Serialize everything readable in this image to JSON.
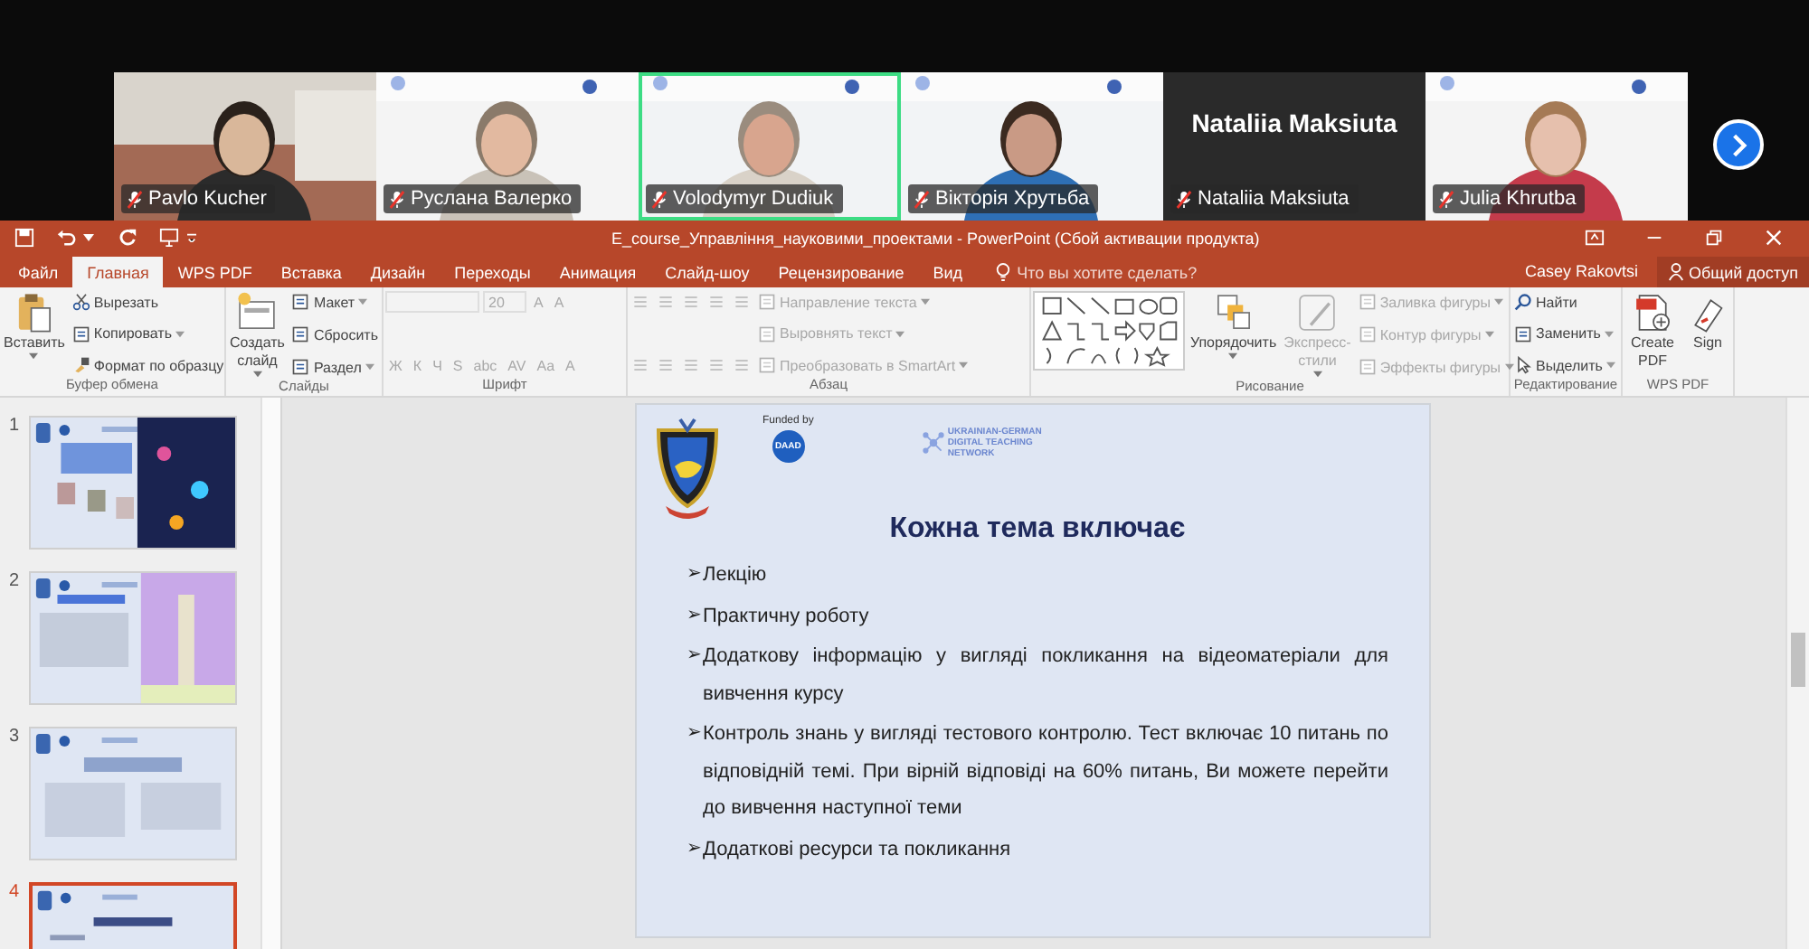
{
  "participants": [
    {
      "name": "Pavlo Kucher",
      "kind": "video",
      "muted": true,
      "selected": false
    },
    {
      "name": "Руслана Валерко",
      "kind": "video",
      "muted": true,
      "selected": false
    },
    {
      "name": "Volodymyr Dudiuk",
      "kind": "video",
      "muted": true,
      "selected": true
    },
    {
      "name": "Вікторія Хрутьба",
      "kind": "video",
      "muted": true,
      "selected": false
    },
    {
      "name": "Nataliia Maksiuta",
      "kind": "name",
      "display_name": "Nataliia Maksiuta",
      "muted": true,
      "selected": false
    },
    {
      "name": "Julia Khrutba",
      "kind": "video",
      "muted": true,
      "selected": false
    }
  ],
  "powerpoint": {
    "title": "E_course_Управління_науковими_проектами - PowerPoint (Сбой активации продукта)",
    "tabs": [
      {
        "label": "Файл",
        "selected": false
      },
      {
        "label": "Главная",
        "selected": true
      },
      {
        "label": "WPS PDF",
        "selected": false
      },
      {
        "label": "Вставка",
        "selected": false
      },
      {
        "label": "Дизайн",
        "selected": false
      },
      {
        "label": "Переходы",
        "selected": false
      },
      {
        "label": "Анимация",
        "selected": false
      },
      {
        "label": "Слайд-шоу",
        "selected": false
      },
      {
        "label": "Рецензирование",
        "selected": false
      },
      {
        "label": "Вид",
        "selected": false
      }
    ],
    "tell_me": {
      "placeholder": "Что вы хотите сделать?"
    },
    "user": "Casey Rakovtsi",
    "share": "Общий доступ",
    "ribbon": [
      {
        "label": "Буфер обмена",
        "columns": [
          [
            [
              {
                "kind": "large",
                "label": "Вставить",
                "dropdown": true,
                "disabled": false
              }
            ]
          ],
          [
            [
              {
                "kind": "small",
                "label": "Вырезать",
                "dropdown": false,
                "disabled": false
              }
            ],
            [
              {
                "kind": "small",
                "label": "Копировать",
                "dropdown": true,
                "disabled": false
              }
            ],
            [
              {
                "kind": "small",
                "label": "Формат по образцу",
                "dropdown": false,
                "disabled": false
              }
            ]
          ]
        ]
      },
      {
        "label": "Слайды",
        "columns": [
          [
            [
              {
                "kind": "large",
                "label": "Создать слайд",
                "dropdown": true,
                "disabled": false
              }
            ]
          ],
          [
            [
              {
                "kind": "small",
                "label": "Макет",
                "dropdown": true,
                "disabled": false
              }
            ],
            [
              {
                "kind": "small",
                "label": "Сбросить",
                "dropdown": false,
                "disabled": false
              }
            ],
            [
              {
                "kind": "small",
                "label": "Раздел",
                "dropdown": true,
                "disabled": false
              }
            ]
          ]
        ]
      },
      {
        "label": "Шрифт",
        "columns": [
          [
            [
              {
                "kind": "field",
                "disabled": true
              },
              {
                "kind": "field",
                "value": "20",
                "disabled": true
              },
              {
                "kind": "glyph",
                "label": "A",
                "disabled": true
              },
              {
                "kind": "glyph",
                "label": "A",
                "disabled": true
              }
            ],
            [
              {
                "kind": "glyph",
                "label": "Ж",
                "disabled": true
              },
              {
                "kind": "glyph",
                "label": "К",
                "disabled": true
              },
              {
                "kind": "glyph",
                "label": "Ч",
                "disabled": true
              },
              {
                "kind": "glyph",
                "label": "S",
                "disabled": true
              },
              {
                "kind": "glyph",
                "label": "abc",
                "disabled": true
              },
              {
                "kind": "glyph",
                "label": "AV",
                "disabled": true
              },
              {
                "kind": "glyph",
                "label": "Aa",
                "disabled": true
              },
              {
                "kind": "glyph",
                "label": "A",
                "disabled": true
              }
            ]
          ]
        ]
      },
      {
        "label": "Абзац",
        "columns": [
          [
            [
              {
                "kind": "icon",
                "disabled": true
              },
              {
                "kind": "icon",
                "disabled": true
              },
              {
                "kind": "icon",
                "disabled": true
              },
              {
                "kind": "icon",
                "disabled": true
              },
              {
                "kind": "icon",
                "disabled": true
              }
            ],
            [
              {
                "kind": "icon",
                "disabled": true
              },
              {
                "kind": "icon",
                "disabled": true
              },
              {
                "kind": "icon",
                "disabled": true
              },
              {
                "kind": "icon",
                "disabled": true
              },
              {
                "kind": "icon",
                "disabled": true
              }
            ]
          ],
          [
            [
              {
                "kind": "small",
                "label": "Направление текста",
                "dropdown": true,
                "disabled": true
              }
            ],
            [
              {
                "kind": "small",
                "label": "Выровнять текст",
                "dropdown": true,
                "disabled": true
              }
            ],
            [
              {
                "kind": "small",
                "label": "Преобразовать в SmartArt",
                "dropdown": true,
                "disabled": true
              }
            ]
          ]
        ]
      },
      {
        "label": "Рисование",
        "columns": [
          [
            [
              {
                "kind": "gallery"
              }
            ]
          ],
          [
            [
              {
                "kind": "large",
                "label": "Упорядочить",
                "dropdown": true,
                "disabled": false
              }
            ]
          ],
          [
            [
              {
                "kind": "large",
                "label": "Экспресс-стили",
                "dropdown": true,
                "disabled": true
              }
            ]
          ],
          [
            [
              {
                "kind": "small",
                "label": "Заливка фигуры",
                "dropdown": true,
                "disabled": true
              }
            ],
            [
              {
                "kind": "small",
                "label": "Контур фигуры",
                "dropdown": true,
                "disabled": true
              }
            ],
            [
              {
                "kind": "small",
                "label": "Эффекты фигуры",
                "dropdown": true,
                "disabled": true
              }
            ]
          ]
        ]
      },
      {
        "label": "Редактирование",
        "columns": [
          [
            [
              {
                "kind": "small",
                "label": "Найти",
                "dropdown": false,
                "disabled": false
              }
            ],
            [
              {
                "kind": "small",
                "label": "Заменить",
                "dropdown": true,
                "disabled": false
              }
            ],
            [
              {
                "kind": "small",
                "label": "Выделить",
                "dropdown": true,
                "disabled": false
              }
            ]
          ]
        ]
      },
      {
        "label": "WPS PDF",
        "columns": [
          [
            [
              {
                "kind": "large",
                "label": "Create PDF",
                "dropdown": false,
                "disabled": false
              }
            ]
          ],
          [
            [
              {
                "kind": "large",
                "label": "Sign",
                "dropdown": false,
                "disabled": false
              }
            ]
          ]
        ]
      }
    ],
    "thumbnails": [
      {
        "number": "1",
        "selected": false
      },
      {
        "number": "2",
        "selected": false
      },
      {
        "number": "3",
        "selected": false
      },
      {
        "number": "4",
        "selected": true
      }
    ],
    "slide": {
      "funded_by": "Funded by",
      "daad": "DAAD",
      "network": "UKRAINIAN-GERMAN DIGITAL TEACHING NETWORK",
      "title": "Кожна тема включає",
      "bullet": "➢",
      "bullets": [
        "Лекцію",
        "Практичну роботу",
        "Додаткову інформацію у вигляді покликання на відеоматеріали для вивчення курсу",
        "Контроль знань у вигляді тестового контролю. Тест включає 10 питань по відповідній темі. При вірній  відповіді на 60% питань, Ви можете перейти до вивчення наступної теми",
        "Додаткові ресурси та покликання"
      ]
    }
  }
}
